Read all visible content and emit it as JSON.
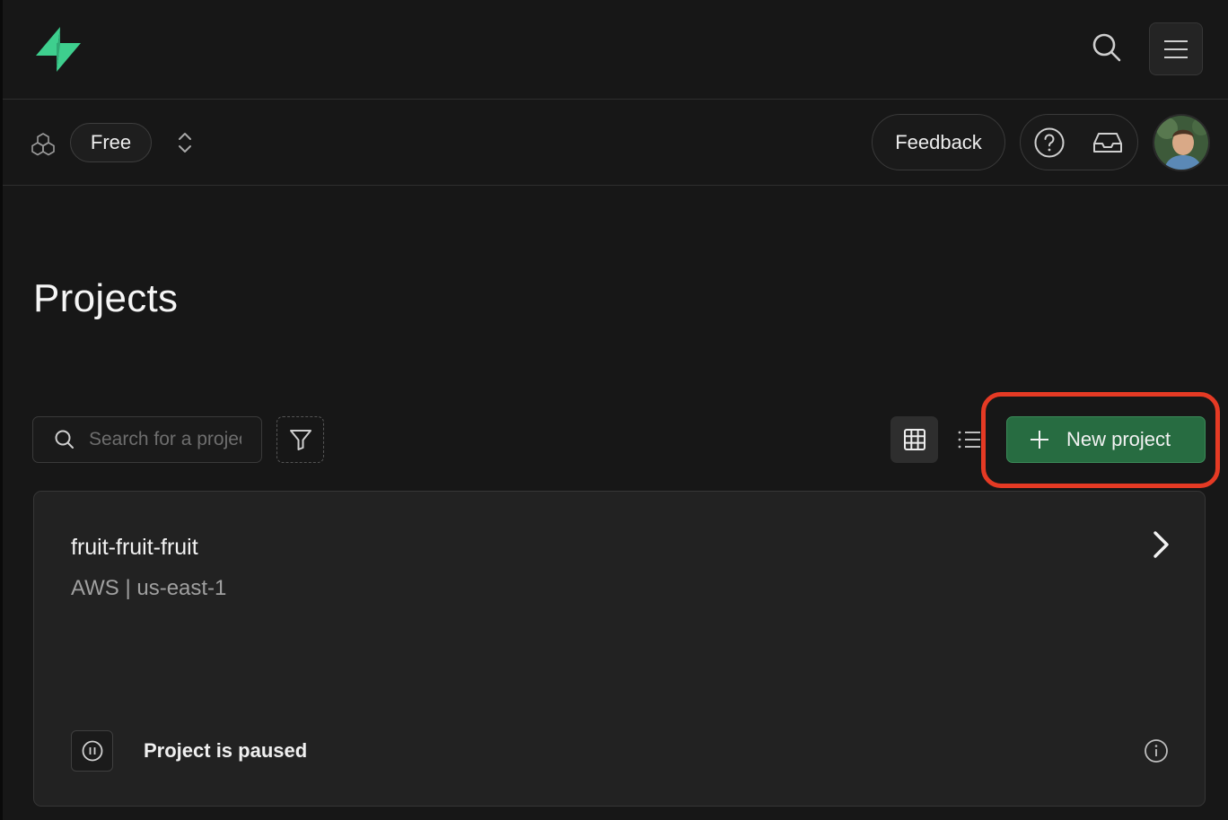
{
  "header": {
    "logo_icon": "supabase-logo-icon",
    "search_icon": "search-icon",
    "menu_icon": "hamburger-menu-icon"
  },
  "org_bar": {
    "org_icon": "organization-icon",
    "plan_label": "Free",
    "switch_icon": "chevron-up-down-icon",
    "feedback_label": "Feedback",
    "help_icon": "help-icon",
    "inbox_icon": "inbox-icon",
    "avatar_icon": "user-avatar"
  },
  "main": {
    "title": "Projects",
    "search_placeholder": "Search for a project",
    "filter_icon": "filter-icon",
    "grid_view_icon": "grid-view-icon",
    "list_view_icon": "list-view-icon",
    "new_project_label": "New project"
  },
  "projects": [
    {
      "name": "fruit-fruit-fruit",
      "region": "AWS | us-east-1",
      "status": "Project is paused",
      "status_icon": "pause-icon"
    }
  ],
  "colors": {
    "background": "#171717",
    "brand_green": "#3ecf8e",
    "button_green": "#276c41",
    "highlight_red": "#e53a24"
  }
}
